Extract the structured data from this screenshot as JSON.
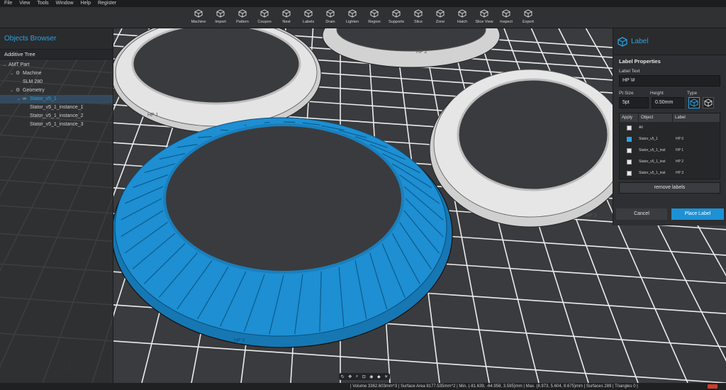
{
  "menu": [
    "File",
    "View",
    "Tools",
    "Window",
    "Help",
    "Register"
  ],
  "toolbar": [
    {
      "label": "Machine",
      "icon": "machine-icon"
    },
    {
      "label": "Import",
      "icon": "import-icon"
    },
    {
      "label": "Pattern",
      "icon": "pattern-icon"
    },
    {
      "label": "Coupon",
      "icon": "coupon-icon"
    },
    {
      "label": "Nest",
      "icon": "nest-icon"
    },
    {
      "label": "Labels",
      "icon": "labels-icon"
    },
    {
      "label": "Drain",
      "icon": "drain-icon"
    },
    {
      "label": "Lighten",
      "icon": "lighten-icon"
    },
    {
      "label": "Region",
      "icon": "region-icon"
    },
    {
      "label": "Supports",
      "icon": "supports-icon"
    },
    {
      "label": "Slice",
      "icon": "slice-icon"
    },
    {
      "label": "Zone",
      "icon": "zone-icon"
    },
    {
      "label": "Hatch",
      "icon": "hatch-icon"
    },
    {
      "label": "Slice View",
      "icon": "slice-view-icon"
    },
    {
      "label": "Inspect",
      "icon": "inspect-icon"
    },
    {
      "label": "Export",
      "icon": "export-icon"
    }
  ],
  "objects_browser": {
    "title": "Objects Browser",
    "tab": "Additive Tree",
    "tree": [
      {
        "label": "AMT Part",
        "depth": 0,
        "chevron": "⌄",
        "icon": ""
      },
      {
        "label": "Machine",
        "depth": 1,
        "chevron": "⌄",
        "icon": "⚙"
      },
      {
        "label": "SLM 280",
        "depth": 2,
        "chevron": "",
        "icon": ""
      },
      {
        "label": "Geometry",
        "depth": 1,
        "chevron": "⌄",
        "icon": "⚙"
      },
      {
        "label": "Stator_v5_1",
        "depth": 2,
        "chevron": "⌄",
        "icon": "∞",
        "selected": true
      },
      {
        "label": "Stator_v5_1_instance_1",
        "depth": 3,
        "chevron": "",
        "icon": ""
      },
      {
        "label": "Stator_v5_1_instance_2",
        "depth": 3,
        "chevron": "",
        "icon": ""
      },
      {
        "label": "Stator_v5_1_instance_3",
        "depth": 3,
        "chevron": "",
        "icon": ""
      }
    ]
  },
  "label_panel": {
    "title": "Label",
    "section": "Label Properties",
    "label_text_caption": "Label Text",
    "label_text_value": "HP \\#",
    "pt_size_caption": "Pt Size",
    "pt_size_value": "5pt",
    "height_caption": "Height",
    "height_value": "0.50mm",
    "type_caption": "Type",
    "table_headers": [
      "Apply",
      "Object",
      "Label"
    ],
    "rows": [
      {
        "object": "All",
        "label": "",
        "checked": false
      },
      {
        "object": "Stator_v5_1",
        "label": "HP 0",
        "checked": true
      },
      {
        "object": "Stator_v5_1_inst",
        "label": "HP 1",
        "checked": false
      },
      {
        "object": "Stator_v5_1_inst",
        "label": "HP 2",
        "checked": false
      },
      {
        "object": "Stator_v5_1_inst",
        "label": "HP 3",
        "checked": false
      }
    ],
    "remove_label": "remove labels",
    "cancel_label": "Cancel",
    "place_label": "Place Label"
  },
  "status": "| Volume 3362.603mm^3 | Surface Area 8177.535mm^2 | Min. (-81.639, -64.958, 3.595)mm | Max. (8.973, 5.604, 8.675)mm | Surfaces 289 | Triangles 0 |",
  "part_labels": [
    "HP 1",
    "HP 2",
    "HP 3",
    "HP 0"
  ],
  "colors": {
    "accent": "#2ba3e4",
    "selected_part": "#1a86c8",
    "part": "#d9d9d9",
    "grid": "#e8e8e8",
    "background": "#3a3b3e"
  }
}
